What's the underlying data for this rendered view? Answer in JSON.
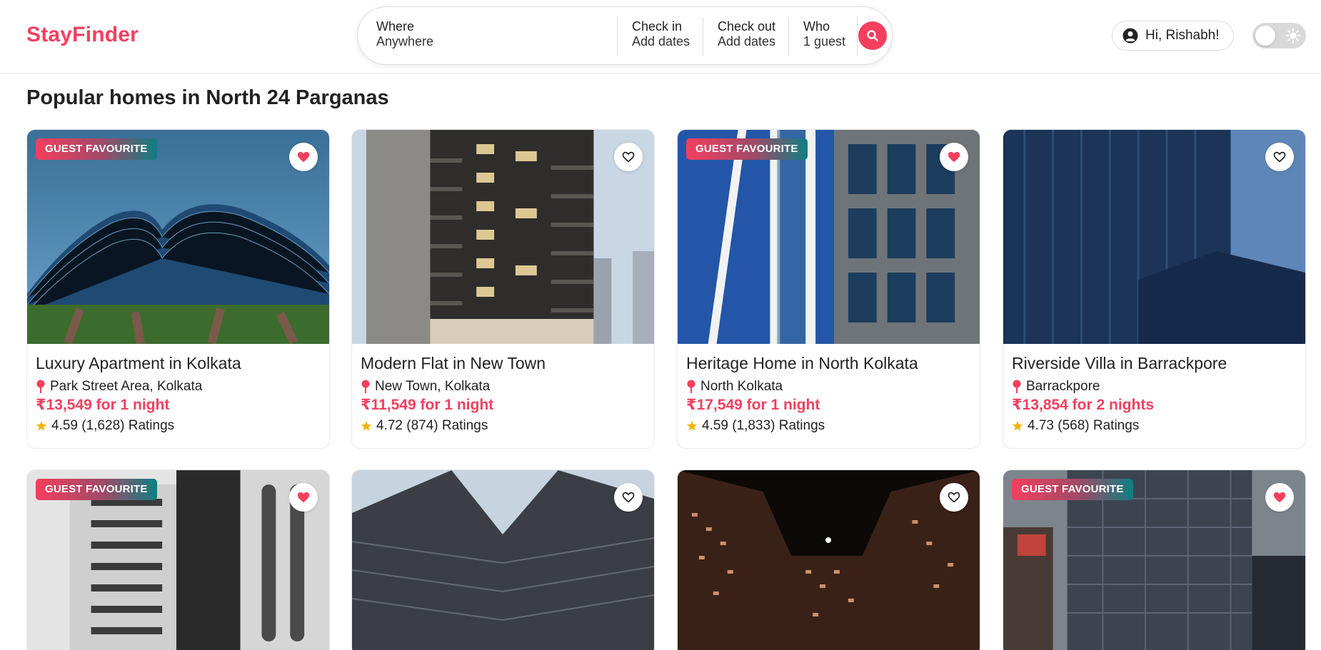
{
  "brand": {
    "name": "StayFinder",
    "color": "#f43f5e"
  },
  "search": {
    "where_label": "Where",
    "where_value": "Anywhere",
    "checkin_label": "Check in",
    "checkin_value": "Add dates",
    "checkout_label": "Check out",
    "checkout_value": "Add dates",
    "who_label": "Who",
    "who_value": "1 guest"
  },
  "user": {
    "greeting": "Hi, Rishabh!"
  },
  "theme_toggle": {
    "dark_mode": false
  },
  "section_title": "Popular homes in North 24 Parganas",
  "listings": [
    {
      "title": "Luxury Apartment in Kolkata",
      "location": "Park Street Area, Kolkata",
      "price": "₹13,549 for 1 night",
      "rating": "4.59 (1,628) Ratings",
      "badge": "GUEST FAVOURITE",
      "favorited": true
    },
    {
      "title": "Modern Flat in New Town",
      "location": "New Town, Kolkata",
      "price": "₹11,549 for 1 night",
      "rating": "4.72 (874) Ratings",
      "badge": "",
      "favorited": false
    },
    {
      "title": "Heritage Home in North Kolkata",
      "location": "North Kolkata",
      "price": "₹17,549 for 1 night",
      "rating": "4.59 (1,833) Ratings",
      "badge": "GUEST FAVOURITE",
      "favorited": true
    },
    {
      "title": "Riverside Villa in Barrackpore",
      "location": "Barrackpore",
      "price": "₹13,854 for 2 nights",
      "rating": "4.73 (568) Ratings",
      "badge": "",
      "favorited": false
    },
    {
      "badge": "GUEST FAVOURITE",
      "favorited": true
    },
    {
      "badge": "",
      "favorited": false
    },
    {
      "badge": "",
      "favorited": false
    },
    {
      "badge": "GUEST FAVOURITE",
      "favorited": true
    }
  ]
}
